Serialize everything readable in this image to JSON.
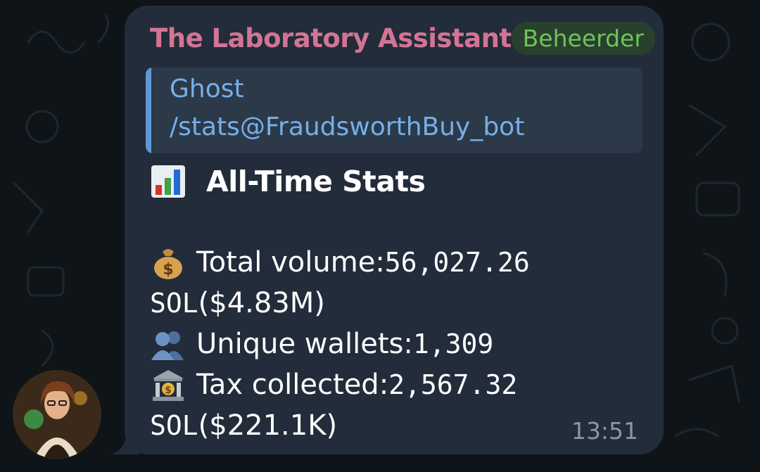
{
  "message": {
    "sender": "The Laboratory Assistant",
    "role_badge": "Beheerder",
    "reply": {
      "author": "Ghost",
      "text": "/stats@FraudsworthBuy_bot"
    },
    "title": "All-Time Stats",
    "stats": {
      "volume_label": "Total volume: ",
      "volume_value": "56,027.26",
      "volume_unit": "SOL",
      "volume_usd": " ($4.83M)",
      "wallets_label": "Unique wallets: ",
      "wallets_value": "1,309",
      "tax_label": "Tax collected: ",
      "tax_value": "2,567.32",
      "tax_unit": "SOL",
      "tax_usd": " ($221.1K)"
    },
    "timestamp": "13:51"
  },
  "icons": {
    "title": "bar-chart-icon",
    "volume": "money-bag-icon",
    "wallets": "busts-icon",
    "tax": "bank-icon"
  },
  "colors": {
    "bubble": "#222c3a",
    "sender": "#d37495",
    "badge_text": "#6fc35a",
    "reply_accent": "#5d99d6"
  }
}
